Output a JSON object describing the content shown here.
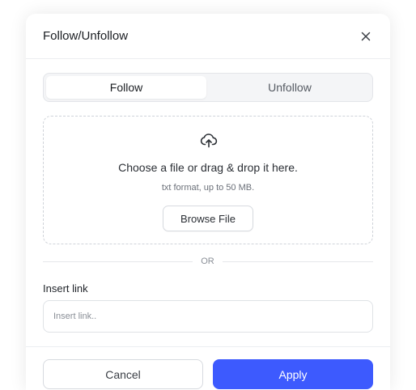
{
  "dialog": {
    "title": "Follow/Unfollow",
    "close_icon": "close-icon"
  },
  "tabs": [
    {
      "label": "Follow",
      "active": true
    },
    {
      "label": "Unfollow",
      "active": false
    }
  ],
  "upload": {
    "icon": "cloud-upload-icon",
    "title": "Choose a file or drag & drop it here.",
    "subtitle": "txt format, up to 50 MB.",
    "browse_label": "Browse File"
  },
  "divider": {
    "label": "OR"
  },
  "link": {
    "label": "Insert link",
    "placeholder": "Insert link..",
    "value": ""
  },
  "footer": {
    "cancel_label": "Cancel",
    "apply_label": "Apply"
  },
  "colors": {
    "accent": "#3d5afe",
    "border": "#d7dadf",
    "tab_bg": "#f4f5f7"
  }
}
